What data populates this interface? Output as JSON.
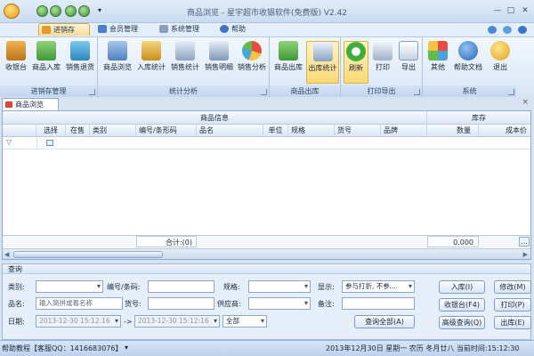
{
  "window": {
    "title": "商品浏览 - 星宇超市收银软件(免费版) V2.42",
    "controls": [
      "—",
      "□",
      "✕"
    ]
  },
  "qat": {
    "separator": "▾"
  },
  "tabs": [
    {
      "label": "进销存",
      "active": true
    },
    {
      "label": "会员管理"
    },
    {
      "label": "系统管理"
    },
    {
      "label": "帮助"
    }
  ],
  "ribbon": {
    "groups": [
      {
        "label": "进销存管理",
        "buttons": [
          "收银台",
          "商品入库",
          "销售退货"
        ]
      },
      {
        "label": "统计分析",
        "buttons": [
          "商品浏览",
          "入库统计",
          "销售统计",
          "销售明细",
          "销售分析"
        ]
      },
      {
        "label": "商品出库",
        "buttons": [
          "商品出库",
          "出库统计"
        ]
      },
      {
        "label": "打印导出",
        "buttons": [
          "刷新",
          "打印",
          "导出"
        ]
      },
      {
        "label": "系统",
        "buttons": [
          "其他",
          "帮助文档",
          "退出"
        ]
      }
    ]
  },
  "doc_tab": {
    "label": "商品浏览",
    "close": "×"
  },
  "grid": {
    "band_headers": {
      "info": "商品信息",
      "stock": "库存"
    },
    "columns": [
      "选择",
      "在售",
      "类别",
      "编号/条形码",
      "品名",
      "单位",
      "规格",
      "货号",
      "品牌",
      "数量",
      "成本价"
    ],
    "filter_icon": "▽",
    "footer": {
      "total_label": "合计:(0)",
      "qty_total": "0.000",
      "ellipsis": "..."
    }
  },
  "query": {
    "header": "查询",
    "labels": {
      "category": "类别:",
      "code": "编号/条码:",
      "spec": "规格:",
      "show": "显示:",
      "name": "品名:",
      "item_no": "货号:",
      "supplier": "供应商:",
      "remark": "备注:",
      "date": "日期:",
      "arrow": "->"
    },
    "values": {
      "name_placeholder": "输入简拼或着名称",
      "show_value": "参与打折, 不参...",
      "date_from": "2013-12-30 15:12:16",
      "date_to": "2013-12-30 15:12:16",
      "date_range": "全部"
    },
    "buttons": {
      "query_all": "查询全部(A)",
      "stock_in": "入库(I)",
      "modify": "修改(M)",
      "cashier": "收银台(F4)",
      "print": "打印(P)",
      "advanced": "高级查询(Q)",
      "stock_out": "出库(E)"
    }
  },
  "status": {
    "left": "帮助教程【客服QQ：1416683076】",
    "right": "2013年12月30日 星期一 农历 冬月廿八 当前时间:15:12:30",
    "dropdown": "▾"
  },
  "colors": {
    "accent": "#f9db8f",
    "ribbon_bg": "#dbe7f6",
    "border": "#8eabd3"
  }
}
